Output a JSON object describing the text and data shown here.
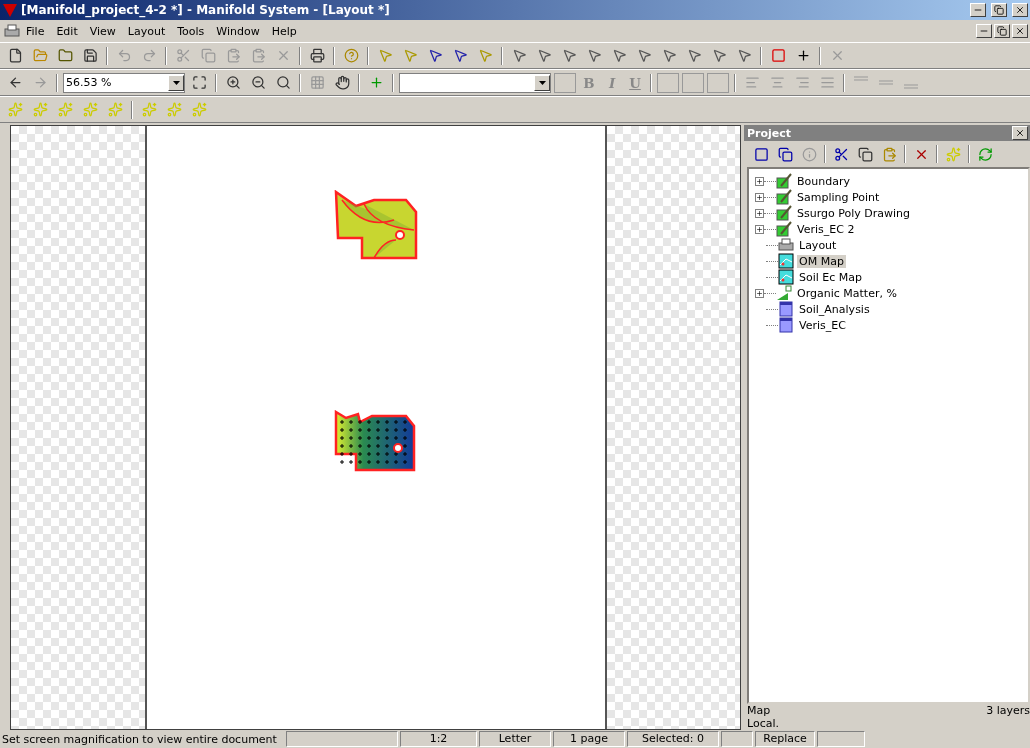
{
  "window": {
    "title": "[Manifold_project_4-2 *] - Manifold System - [Layout *]"
  },
  "menu": [
    "File",
    "Edit",
    "View",
    "Layout",
    "Tools",
    "Window",
    "Help"
  ],
  "zoom": {
    "value": "56.53 %"
  },
  "format_toolbar": {
    "bold": "B",
    "italic": "I",
    "underline": "U"
  },
  "project": {
    "title": "Project",
    "items": [
      {
        "label": "Boundary",
        "kind": "drawing",
        "expandable": true,
        "selected": false
      },
      {
        "label": "Sampling Point",
        "kind": "drawing",
        "expandable": true,
        "selected": false
      },
      {
        "label": "Ssurgo Poly Drawing",
        "kind": "drawing",
        "expandable": true,
        "selected": false
      },
      {
        "label": "Veris_EC 2",
        "kind": "drawing",
        "expandable": true,
        "selected": false
      },
      {
        "label": "Layout",
        "kind": "layout",
        "expandable": false,
        "selected": false
      },
      {
        "label": "OM Map",
        "kind": "map",
        "expandable": false,
        "selected": true
      },
      {
        "label": "Soil Ec Map",
        "kind": "map",
        "expandable": false,
        "selected": false
      },
      {
        "label": "Organic Matter, %",
        "kind": "theme",
        "expandable": true,
        "selected": false
      },
      {
        "label": "Soil_Analysis",
        "kind": "table",
        "expandable": false,
        "selected": false
      },
      {
        "label": "Veris_EC",
        "kind": "table",
        "expandable": false,
        "selected": false
      }
    ],
    "info": {
      "type": "Map",
      "layers": "3 layers",
      "location": "Local."
    }
  },
  "status_bar": {
    "message": "Set screen magnification to view entire document",
    "fields": [
      {
        "kind": "blank"
      },
      {
        "kind": "text",
        "text": "1:2"
      },
      {
        "kind": "text",
        "text": "Letter"
      },
      {
        "kind": "text",
        "text": "1 page"
      },
      {
        "kind": "text",
        "text": "Selected: 0"
      },
      {
        "kind": "blank"
      },
      {
        "kind": "text",
        "text": "Replace"
      },
      {
        "kind": "blank"
      }
    ]
  }
}
